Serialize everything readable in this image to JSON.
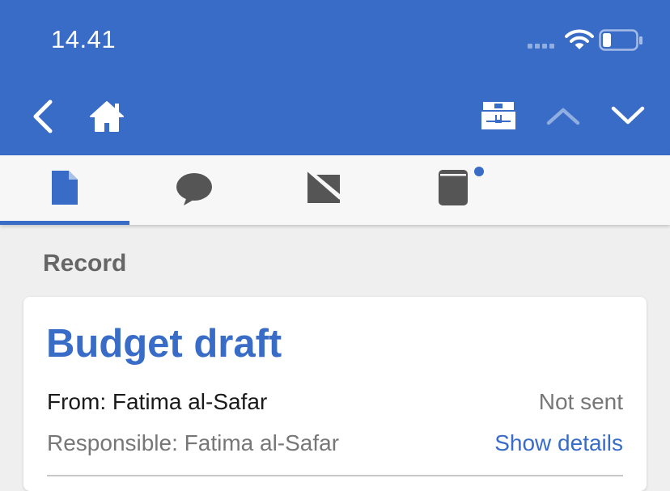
{
  "status_bar": {
    "time": "14.41"
  },
  "nav": {
    "back_icon": "chevron-left-icon",
    "home_icon": "home-icon",
    "cabinet_icon": "cabinet-icon",
    "prev_icon": "chevron-up-icon",
    "next_icon": "chevron-down-icon"
  },
  "tabs": [
    {
      "icon": "document-icon",
      "selected": true
    },
    {
      "icon": "comment-icon",
      "selected": false
    },
    {
      "icon": "envelope-icon",
      "selected": false
    },
    {
      "icon": "notebook-icon",
      "selected": false,
      "has_notification": true
    }
  ],
  "section": {
    "heading": "Record"
  },
  "record": {
    "title": "Budget draft",
    "from": "From: Fatima al-Safar",
    "status": "Not sent",
    "responsible": "Responsible: Fatima al-Safar",
    "show_details": "Show details"
  },
  "colors": {
    "accent": "#386cc7",
    "header_bg": "#386cc7",
    "page_bg": "#efefef",
    "tab_icon": "#555555"
  }
}
